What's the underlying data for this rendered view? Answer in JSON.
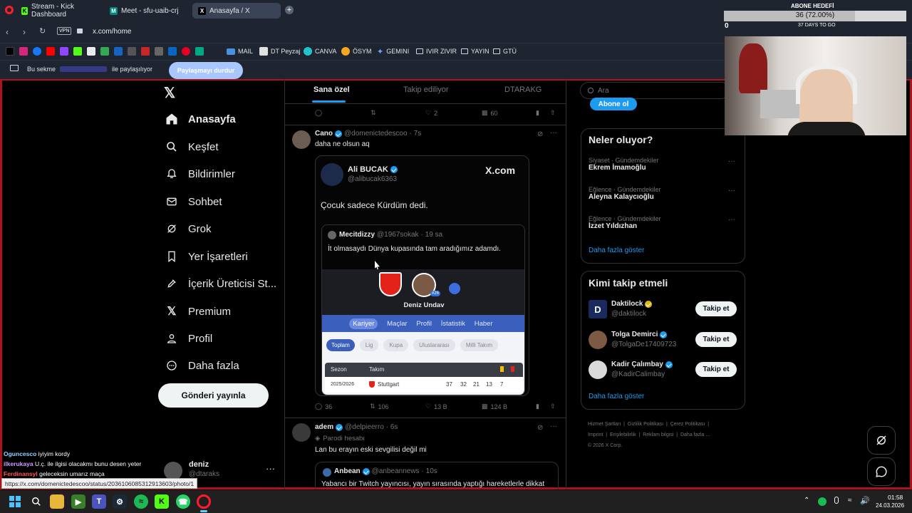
{
  "browser": {
    "tabs": [
      {
        "label": "Stream - Kick Dashboard",
        "icon": "kick-icon"
      },
      {
        "label": "Meet - sfu-uaib-crj",
        "icon": "meet-icon"
      },
      {
        "label": "Anasayfa / X",
        "icon": "x-icon"
      }
    ],
    "url": "x.com/home",
    "vpn_label": "VPN",
    "bookmarks": [
      "MAIL",
      "DT Peyzaj",
      "CANVA",
      "ÖSYM",
      "GEMINI",
      "IVIR ZIVIR",
      "YAYIN",
      "GTÜ"
    ],
    "share_bar": {
      "prefix": "Bu sekme",
      "suffix": "ile paylaşılıyor",
      "stop_button": "Paylaşmayı durdur"
    },
    "status_url": "https://x.com/domenictedescoo/status/2036106085312913603/photo/1"
  },
  "overlay": {
    "goal_title": "ABONE HEDEFİ",
    "goal_progress": "36 (72.00%)",
    "goal_fraction": 0.72,
    "goal_zero": "0",
    "goal_days": "37 DAYS TO GO"
  },
  "nav": {
    "items": [
      {
        "label": "Anasayfa",
        "icon": "home-icon",
        "active": true
      },
      {
        "label": "Keşfet",
        "icon": "search-icon"
      },
      {
        "label": "Bildirimler",
        "icon": "bell-icon"
      },
      {
        "label": "Sohbet",
        "icon": "mail-icon"
      },
      {
        "label": "Grok",
        "icon": "grok-icon"
      },
      {
        "label": "Yer İşaretleri",
        "icon": "bookmark-icon"
      },
      {
        "label": "İçerik Üreticisi St...",
        "icon": "rocket-icon"
      },
      {
        "label": "Premium",
        "icon": "x-icon"
      },
      {
        "label": "Profil",
        "icon": "person-icon"
      },
      {
        "label": "Daha fazla",
        "icon": "more-circle-icon"
      }
    ],
    "post_button": "Gönderi yayınla",
    "account": {
      "name": "deniz",
      "handle": "@dtaraks"
    }
  },
  "timeline": {
    "tabs": [
      "Sana özel",
      "Takip ediliyor",
      "DTARAKG"
    ],
    "prev_actions": {
      "likes": "2",
      "views": "60"
    },
    "post1": {
      "name": "Cano",
      "handle": "@domenictedescoo",
      "time": "· 7s",
      "text": "daha ne olsun aq",
      "embed": {
        "name": "Ali BUCAK",
        "handle": "@alibucak6363",
        "brand": "X.com",
        "text": "Çocuk sadece Kürdüm dedi.",
        "quote": {
          "name": "Mecitdizzy",
          "handle": "@1967sokak",
          "time": "· 19 sa",
          "text": "İt olmasaydı Dünya kupasında tam aradığımız adamdı.",
          "player": "Deniz Undav",
          "badge": "#26",
          "tabs": [
            "Kariyer",
            "Maçlar",
            "Profil",
            "İstatistik",
            "Haber"
          ],
          "chips": [
            "Toplam",
            "Lig",
            "Kupa",
            "Uluslararası",
            "Milli Takım"
          ],
          "table_headers": [
            "Sezon",
            "Takım"
          ],
          "row": {
            "season": "2025/2026",
            "team": "Stuttgart",
            "vals": [
              "37",
              "32",
              "21",
              "13",
              "7"
            ]
          }
        }
      },
      "actions": {
        "replies": "36",
        "reposts": "106",
        "likes": "13 B",
        "views": "124 B"
      }
    },
    "post2": {
      "name": "adem",
      "handle": "@delpieerro",
      "time": "· 6s",
      "label": "Parodi hesabı",
      "text": "Lan bu erayın eski sevgilisi değil mi",
      "quote": {
        "name": "Anbean",
        "handle": "@anbeannews",
        "time": "· 10s",
        "text": "Yabancı bir Twitch yayıncısı, yayın sırasında yaptığı hareketlerle dikkat"
      }
    }
  },
  "right": {
    "search_placeholder": "Ara",
    "subscribe_button": "Abone ol",
    "trends_title": "Neler oluyor?",
    "trends": [
      {
        "cat": "Siyaset · Gündemdekiler",
        "name": "Ekrem İmamoğlu"
      },
      {
        "cat": "Eğlence · Gündemdekiler",
        "name": "Aleyna Kalaycıoğlu"
      },
      {
        "cat": "Eğlence · Gündemdekiler",
        "name": "İzzet Yıldızhan"
      }
    ],
    "show_more": "Daha fazla göster",
    "follow_title": "Kimi takip etmeli",
    "follow": [
      {
        "name": "Daktilock",
        "handle": "@daktilock",
        "badge": "gold"
      },
      {
        "name": "Tolga Demirci",
        "handle": "@TolgaDe17409723",
        "badge": "blue"
      },
      {
        "name": "Kadir Çalımbay",
        "handle": "@KadirCalimbay",
        "badge": "blue"
      }
    ],
    "follow_button": "Takip et",
    "footer": [
      "Hizmet Şartları",
      "Gizlilik Politikası",
      "Çerez Politikası",
      "Imprint",
      "Erişilebilirlik",
      "Reklam bilgisi",
      "Daha fazla ...",
      "© 2026 X Corp."
    ]
  },
  "chat": [
    {
      "user": "Oguncesco",
      "msg": "iyiyim kordy",
      "color": "#8fd3ff"
    },
    {
      "user": "ilkerukaya",
      "msg": "U.ç. ile ilgisi olacakmı bunu desen yeter",
      "color": "#d39cff"
    },
    {
      "user": "Ferdinansyl",
      "msg": "geleceksin umarız maça",
      "color": "#ff5a5a"
    }
  ],
  "taskbar": {
    "time": "01:58",
    "date": "24.03.2026"
  }
}
